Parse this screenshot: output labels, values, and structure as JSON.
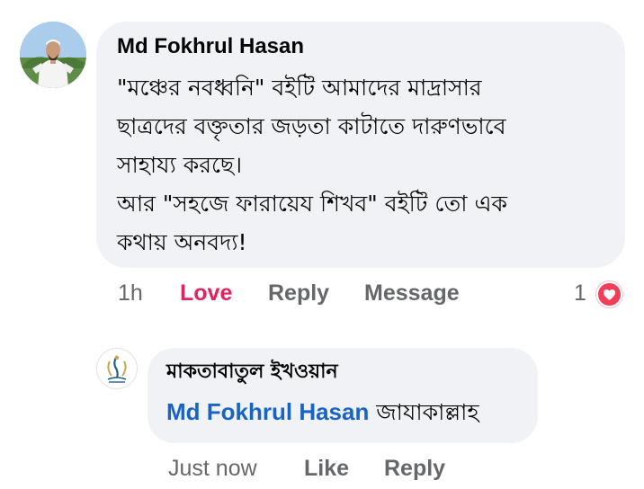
{
  "comment": {
    "author": "Md Fokhrul Hasan",
    "lines": [
      "\"মঞ্চের নবধ্বনি\" বইটি আমাদের মাদ্রাসার",
      "ছাত্রদের বক্তৃতার জড়তা কাটাতে দারুণভাবে",
      "সাহায্য করছে।",
      "আর \"সহজে ফারায়েয শিখব\" বইটি তো এক",
      "কথায় অনবদ্য!"
    ],
    "time": "1h",
    "love_label": "Love",
    "reply_label": "Reply",
    "message_label": "Message",
    "reaction_count": "1",
    "reaction_icon": "heart-icon",
    "reaction_color": "#f33e58"
  },
  "reply": {
    "author": "মাকতাবাতুল ইখওয়ান",
    "mention": "Md Fokhrul Hasan",
    "text": " জাযাকাল্লাহ",
    "time": "Just now",
    "like_label": "Like",
    "reply_label": "Reply"
  },
  "colors": {
    "bubble": "#f0f2f5",
    "mention": "#1864c4",
    "love": "#e0245e",
    "secondary_text": "#65676b"
  }
}
